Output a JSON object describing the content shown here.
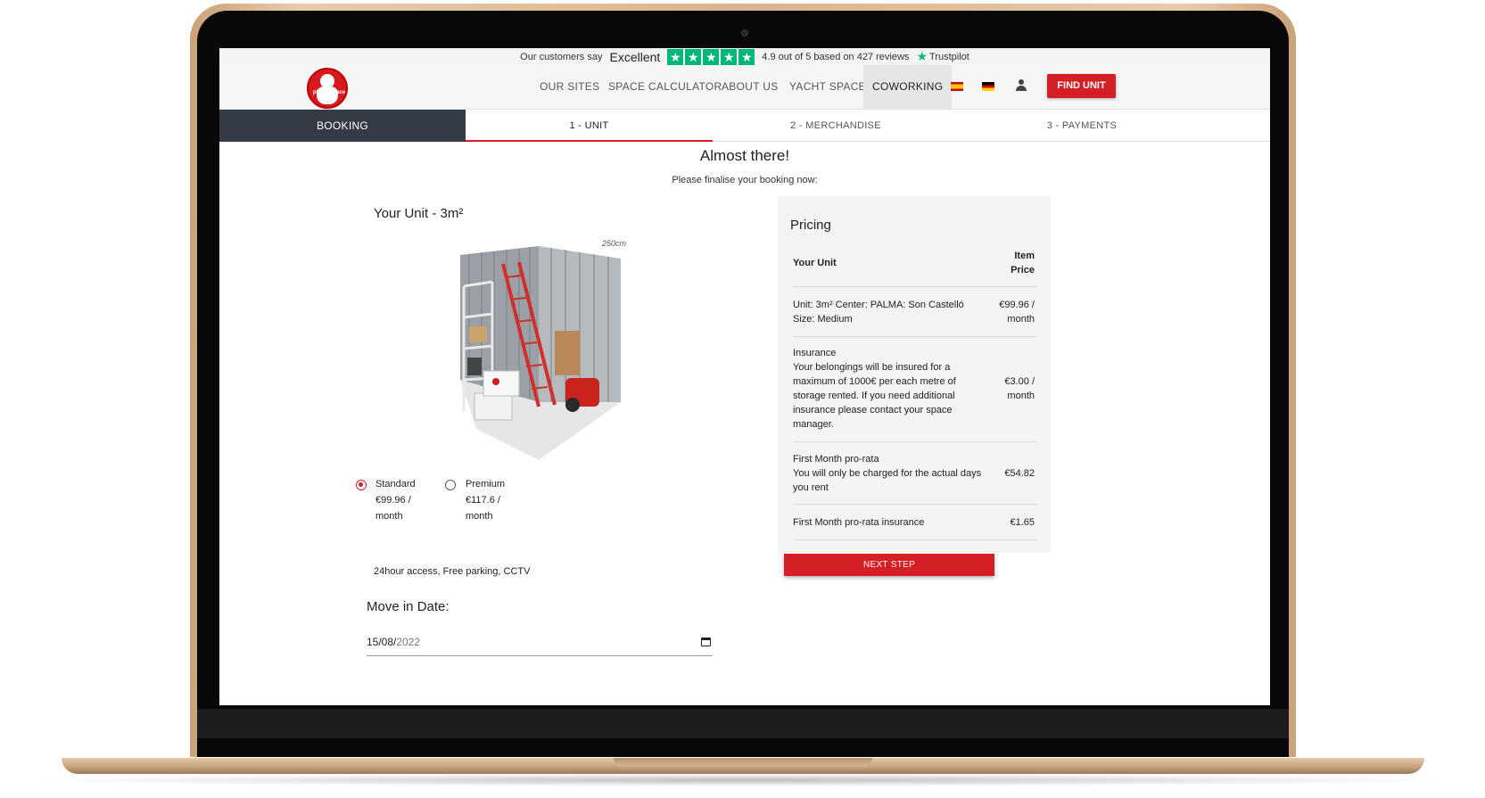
{
  "trustbar": {
    "say": "Our customers say",
    "rating_word": "Excellent",
    "stars": 5,
    "rating_text": "4.9 out of 5 based on",
    "reviews": "427 reviews",
    "brand": "Trustpilot"
  },
  "logo": {
    "text": "planet space"
  },
  "nav": {
    "items": [
      "OUR SITES",
      "SPACE CALCULATOR",
      "ABOUT US",
      "YACHT SPACE",
      "COWORKING"
    ],
    "active": "COWORKING",
    "find_unit": "FIND UNIT"
  },
  "steps": {
    "booking": "BOOKING",
    "unit": "1 - UNIT",
    "merchandise": "2 - MERCHANDISE",
    "payments": "3 - PAYMENTS",
    "active": "1 - UNIT"
  },
  "main": {
    "heading": "Almost there!",
    "subheading": "Please finalise your booking now:",
    "unit_title": "Your Unit - 3m²",
    "dimension_label": "250cm",
    "options": [
      {
        "name": "Standard",
        "price": "€99.96 /",
        "period": "month",
        "selected": true
      },
      {
        "name": "Premium",
        "price": "€117.6 /",
        "period": "month",
        "selected": false
      }
    ],
    "amenities": "24hour access, Free parking, CCTV",
    "move_in_label": "Move in Date:",
    "move_in_dm": "15/08/",
    "move_in_year": "2022"
  },
  "pricing": {
    "title": "Pricing",
    "col_left": "Your Unit",
    "col_right_1": "Item",
    "col_right_2": "Price",
    "rows": [
      {
        "lines": [
          "Unit: 3m² Center: PALMA: Son Castelló",
          "Size: Medium"
        ],
        "price_lines": [
          "€99.96 /",
          "month"
        ]
      },
      {
        "lines": [
          "Insurance",
          "Your belongings will be insured for a",
          "maximum of 1000€ per each metre of",
          "storage rented. If you need additional",
          "insurance please contact your space",
          "manager."
        ],
        "price_lines": [
          "€3.00 /",
          "month"
        ]
      },
      {
        "lines": [
          "First Month pro-rata",
          "You will only be charged for the actual days",
          "you rent"
        ],
        "price_lines": [
          "€54.82"
        ]
      },
      {
        "lines": [
          "First Month pro-rata insurance"
        ],
        "price_lines": [
          "€1.65"
        ]
      }
    ],
    "next": "NEXT STEP"
  },
  "colors": {
    "accent": "#d51f26",
    "dark": "#333c46",
    "trust": "#00b67a"
  }
}
